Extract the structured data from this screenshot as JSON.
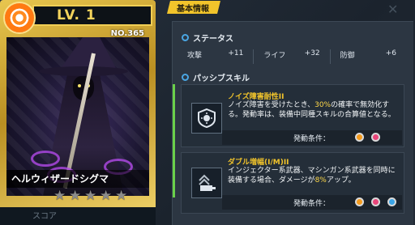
{
  "card": {
    "level": "LV.  1",
    "number": "NO.365",
    "name": "ヘルウィザードシグマ",
    "stars": [
      "★",
      "★",
      "★",
      "★",
      "★"
    ],
    "score_label": "スコア"
  },
  "panel": {
    "tab_label": "基本情報",
    "status_header": "ステータス",
    "stats": [
      {
        "label": "攻撃",
        "value": "+11"
      },
      {
        "label": "ライフ",
        "value": "+32"
      },
      {
        "label": "防御",
        "value": "+6"
      }
    ],
    "passive_header": "パッシブスキル",
    "skills": [
      {
        "name": "ノイズ障害耐性II",
        "desc_before": "ノイズ障害を受けたとき、",
        "desc_highlight": "30%",
        "desc_after": "の確率で無効化する。発動率は、装備中同種スキルの合算値となる。",
        "condition_label": "発動条件："
      },
      {
        "name": "ダブル増幅(I/M)II",
        "desc_before": "インジェクター系武器、マシンガン系武器を同時に装備する場合、ダメージが",
        "desc_highlight": "8%",
        "desc_after": "アップ。",
        "condition_label": "発動条件："
      }
    ]
  },
  "colors": {
    "accent_yellow": "#f2c42b",
    "highlight_green": "#6ad04a",
    "dot_orange": "#f39a1d",
    "dot_pink": "#e8457a",
    "dot_blue": "#3aa4e6"
  }
}
